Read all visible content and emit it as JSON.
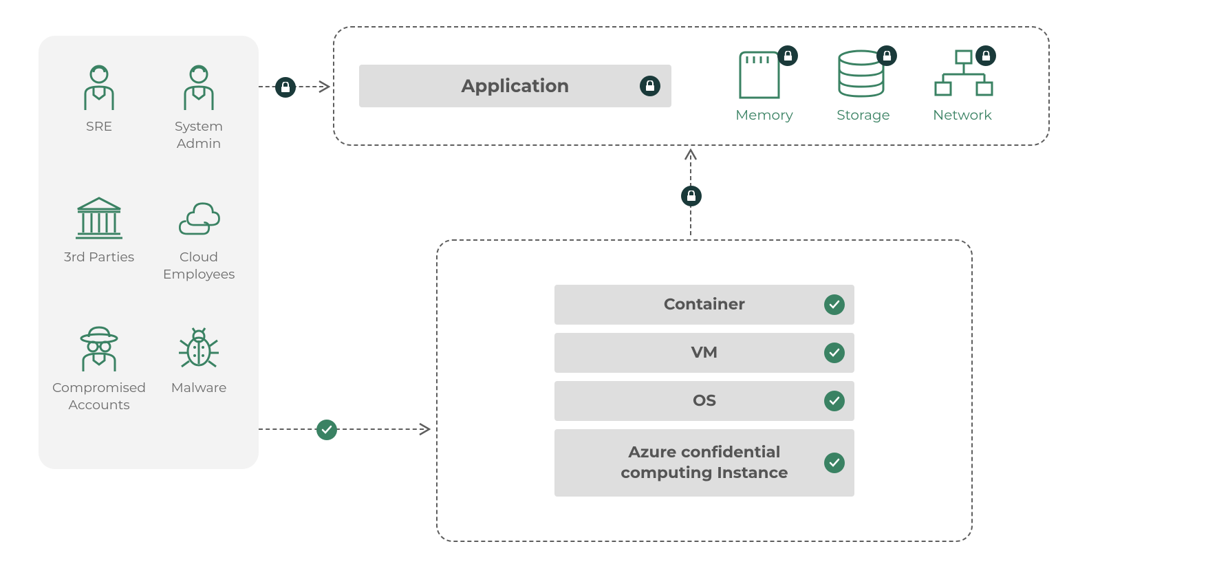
{
  "threats": {
    "items": [
      {
        "label": "SRE",
        "icon": "person"
      },
      {
        "label": "System Admin",
        "icon": "person"
      },
      {
        "label": "3rd Parties",
        "icon": "institution"
      },
      {
        "label": "Cloud Employees",
        "icon": "cloud"
      },
      {
        "label": "Compromised Accounts",
        "icon": "spy"
      },
      {
        "label": "Malware",
        "icon": "bug"
      }
    ]
  },
  "top_box": {
    "application_label": "Application",
    "resources": [
      {
        "label": "Memory",
        "icon": "memory"
      },
      {
        "label": "Storage",
        "icon": "storage"
      },
      {
        "label": "Network",
        "icon": "network"
      }
    ]
  },
  "bottom_box": {
    "stack": [
      {
        "label": "Container"
      },
      {
        "label": "VM"
      },
      {
        "label": "OS"
      },
      {
        "label": "Azure confidential computing Instance"
      }
    ]
  },
  "icons": {
    "lock": "lock",
    "check": "check"
  }
}
